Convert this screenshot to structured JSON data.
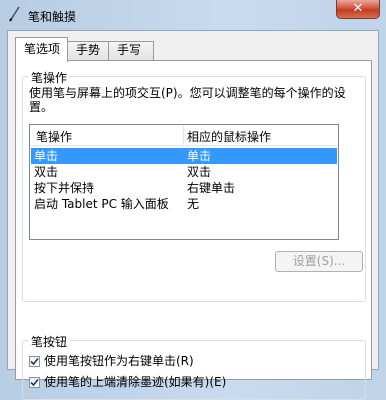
{
  "window": {
    "title": "笔和触摸",
    "close_glyph": "✕"
  },
  "tabs": [
    {
      "label": "笔选项",
      "active": true
    },
    {
      "label": "手势",
      "active": false
    },
    {
      "label": "手写",
      "active": false
    }
  ],
  "pen_actions": {
    "group_label": "笔操作",
    "description": "使用笔与屏幕上的项交互(P)。您可以调整笔的每个操作的设置。",
    "columns": [
      "笔操作",
      "相应的鼠标操作"
    ],
    "rows": [
      {
        "action": "单击",
        "mouse": "单击",
        "selected": true
      },
      {
        "action": "双击",
        "mouse": "双击",
        "selected": false
      },
      {
        "action": "按下并保持",
        "mouse": "右键单击",
        "selected": false
      },
      {
        "action": "启动 Tablet PC 输入面板",
        "mouse": "无",
        "selected": false
      }
    ],
    "settings_button": "设置(S)..."
  },
  "pen_buttons": {
    "group_label": "笔按钮",
    "options": [
      {
        "label": "使用笔按钮作为右键单击(R)",
        "checked": true
      },
      {
        "label": "使用笔的上端清除墨迹(如果有)(E)",
        "checked": true
      }
    ]
  },
  "colors": {
    "selection": "#3399ff",
    "close_button": "#c43b24"
  }
}
